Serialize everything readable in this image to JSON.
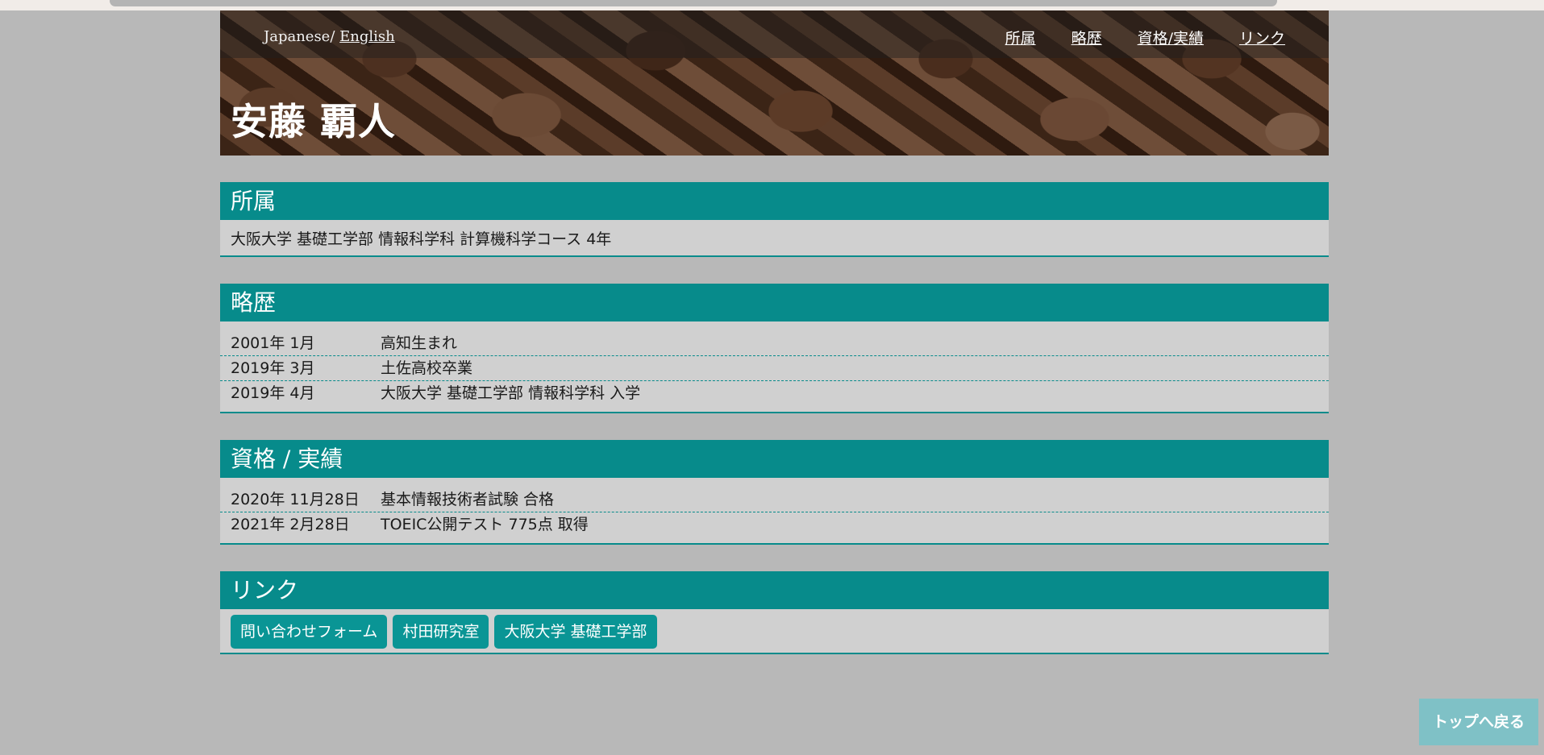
{
  "header": {
    "lang_current": "Japanese/",
    "lang_link": "English",
    "nav": [
      "所属",
      "略歴",
      "資格/実績",
      "リンク"
    ],
    "name": "安藤 覇人"
  },
  "affiliation": {
    "title": "所属",
    "text": "大阪大学 基礎工学部 情報科学科 計算機科学コース 4年"
  },
  "history": {
    "title": "略歴",
    "rows": [
      {
        "date": "2001年  1月",
        "event": "高知生まれ"
      },
      {
        "date": "2019年  3月",
        "event": "土佐高校卒業"
      },
      {
        "date": "2019年  4月",
        "event": "大阪大学 基礎工学部 情報科学科 入学"
      }
    ]
  },
  "qualifications": {
    "title": "資格 / 実績",
    "rows": [
      {
        "date": "2020年  11月28日",
        "event": "基本情報技術者試験 合格"
      },
      {
        "date": "2021年  2月28日",
        "event": "TOEIC公開テスト 775点 取得"
      }
    ]
  },
  "links": {
    "title": "リンク",
    "buttons": [
      "問い合わせフォーム",
      "村田研究室",
      "大阪大学 基礎工学部"
    ]
  },
  "back_to_top": "トップへ戻る",
  "colors": {
    "accent": "#078b8b",
    "page_bg": "#b8b8b8",
    "panel_bg": "#d0d0d0",
    "to_top_bg": "#7fc1c6"
  }
}
